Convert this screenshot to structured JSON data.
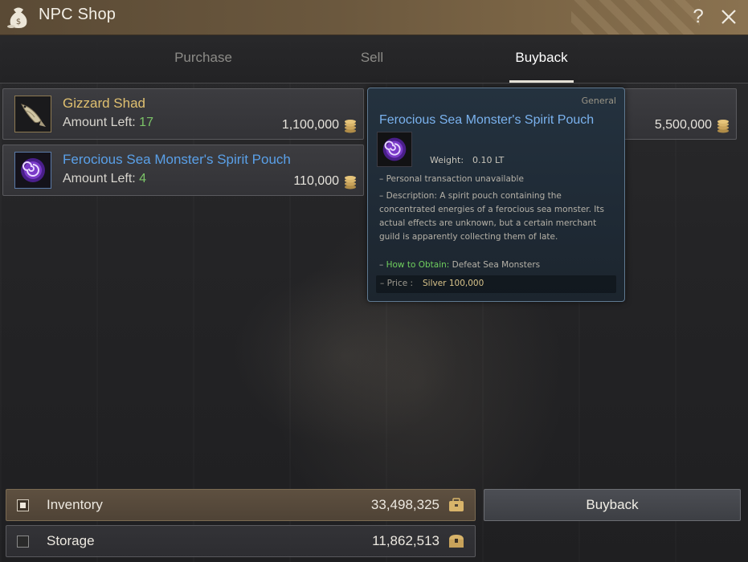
{
  "window": {
    "title": "NPC Shop",
    "help_label": "?"
  },
  "tabs": [
    {
      "label": "Purchase"
    },
    {
      "label": "Sell"
    },
    {
      "label": "Buyback",
      "active": true
    }
  ],
  "items": [
    {
      "name": "Gizzard Shad",
      "amount_label": "Amount Left:",
      "amount": "17",
      "price": "1,100,000",
      "name_color": "#e0c070"
    },
    {
      "name": "Ferocious Sea Monster's Spirit Pouch",
      "amount_label": "Amount Left:",
      "amount": "4",
      "price": "110,000",
      "name_color": "#5aa0e8"
    },
    {
      "price": "5,500,000"
    }
  ],
  "tooltip": {
    "category": "General",
    "title": "Ferocious Sea Monster's Spirit Pouch",
    "weight_label": "Weight:",
    "weight_value": "0.10 LT",
    "transaction": "– Personal transaction unavailable",
    "description": "– Description: A spirit pouch containing the concentrated energies of a ferocious sea monster. Its actual effects are unknown, but a certain merchant guild is apparently collecting them of late.",
    "obtain_label": "How to Obtain:",
    "obtain_value": "Defeat Sea Monsters",
    "price_label": "– Price :",
    "price_value": "Silver 100,000"
  },
  "bottom": {
    "inventory_label": "Inventory",
    "inventory_amount": "33,498,325",
    "storage_label": "Storage",
    "storage_amount": "11,862,513",
    "buyback_button": "Buyback"
  }
}
